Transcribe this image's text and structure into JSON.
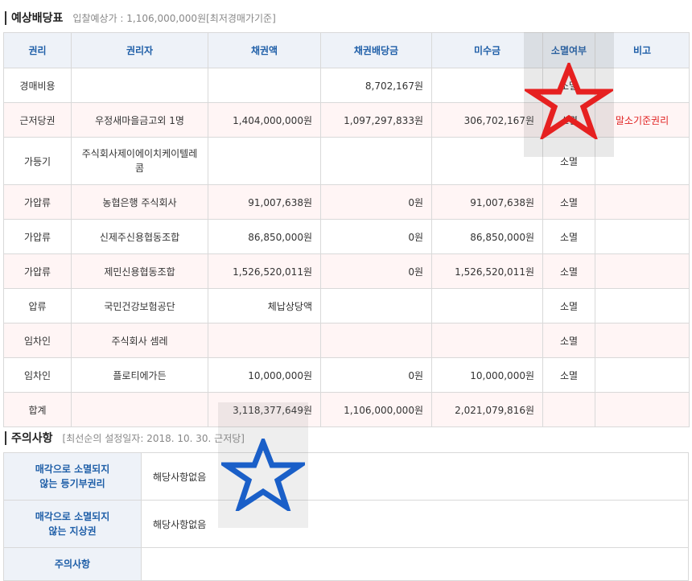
{
  "dividend": {
    "title": "예상배당표",
    "subtitle": "입찰예상가 : 1,106,000,000원[최저경매가기준]",
    "headers": [
      "권리",
      "권리자",
      "채권액",
      "채권배당금",
      "미수금",
      "소멸여부",
      "비고"
    ],
    "rows": [
      {
        "right": "경매비용",
        "holder": "",
        "claim": "",
        "dividend": "8,702,167원",
        "unpaid": "",
        "extinct": "소멸",
        "note": ""
      },
      {
        "right": "근저당권",
        "holder": "우정새마을금고외 1명",
        "claim": "1,404,000,000원",
        "dividend": "1,097,297,833원",
        "unpaid": "306,702,167원",
        "extinct": "소멸",
        "note": "말소기준권리"
      },
      {
        "right": "가등기",
        "holder": "주식회사제이에이치케이텔레콤",
        "claim": "",
        "dividend": "",
        "unpaid": "",
        "extinct": "소멸",
        "note": ""
      },
      {
        "right": "가압류",
        "holder": "농협은행 주식회사",
        "claim": "91,007,638원",
        "dividend": "0원",
        "unpaid": "91,007,638원",
        "extinct": "소멸",
        "note": ""
      },
      {
        "right": "가압류",
        "holder": "신제주신용협동조합",
        "claim": "86,850,000원",
        "dividend": "0원",
        "unpaid": "86,850,000원",
        "extinct": "소멸",
        "note": ""
      },
      {
        "right": "가압류",
        "holder": "제민신용협동조합",
        "claim": "1,526,520,011원",
        "dividend": "0원",
        "unpaid": "1,526,520,011원",
        "extinct": "소멸",
        "note": ""
      },
      {
        "right": "압류",
        "holder": "국민건강보험공단",
        "claim": "체납상당액",
        "dividend": "",
        "unpaid": "",
        "extinct": "소멸",
        "note": ""
      },
      {
        "right": "임차인",
        "holder": "주식회사 셈레",
        "claim": "",
        "dividend": "",
        "unpaid": "",
        "extinct": "소멸",
        "note": ""
      },
      {
        "right": "임차인",
        "holder": "플로티에가든",
        "claim": "10,000,000원",
        "dividend": "0원",
        "unpaid": "10,000,000원",
        "extinct": "소멸",
        "note": ""
      },
      {
        "right": "합계",
        "holder": "",
        "claim": "3,118,377,649원",
        "dividend": "1,106,000,000원",
        "unpaid": "2,021,079,816원",
        "extinct": "",
        "note": ""
      }
    ]
  },
  "notes": {
    "title": "주의사항",
    "subtitle": "[최선순의 설정일자: 2018. 10. 30. 근저당]",
    "rows": [
      {
        "label1": "매각으로 소멸되지",
        "label2": "않는 등기부권리",
        "value": "해당사항없음"
      },
      {
        "label1": "매각으로 소멸되지",
        "label2": "않는 지상권",
        "value": "해당사항없음"
      },
      {
        "label1": "주의사항",
        "label2": "",
        "value": ""
      }
    ]
  },
  "annotations": {
    "red_star_color": "#e62020",
    "blue_star_color": "#1a5fc8",
    "red_star_icon": "star-outline-icon",
    "blue_star_icon": "star-outline-icon"
  }
}
